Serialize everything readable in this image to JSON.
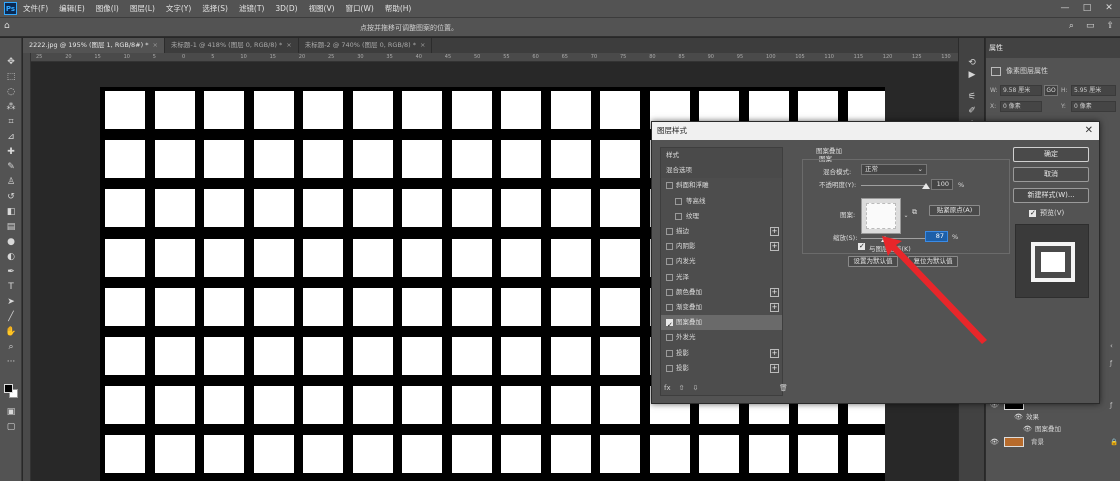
{
  "app": {
    "logo": "Ps"
  },
  "menu": [
    "文件(F)",
    "编辑(E)",
    "图像(I)",
    "图层(L)",
    "文字(Y)",
    "选择(S)",
    "滤镜(T)",
    "3D(D)",
    "视图(V)",
    "窗口(W)",
    "帮助(H)"
  ],
  "window_controls": {
    "minimize": "—",
    "maximize": "□",
    "close": "✕"
  },
  "options_bar": {
    "hint": "点按并拖移可调整图案的位置。"
  },
  "tabs": [
    {
      "label": "2222.jpg @ 195% (图层 1, RGB/8#) *",
      "close": "×"
    },
    {
      "label": "未标题-1 @ 418% (图层 0, RGB/8) *",
      "close": "×"
    },
    {
      "label": "未标题-2 @ 740% (图层 0, RGB/8) *",
      "close": "×"
    }
  ],
  "ruler_labels": [
    "25",
    "20",
    "15",
    "10",
    "5",
    "0",
    "5",
    "10",
    "15",
    "20",
    "25",
    "30",
    "35",
    "40",
    "45",
    "50",
    "55",
    "60",
    "65",
    "70",
    "75",
    "80",
    "85",
    "90",
    "95",
    "100",
    "105",
    "110",
    "115",
    "120",
    "125",
    "130"
  ],
  "properties": {
    "tab": "属性",
    "title": "像素图层属性",
    "w_label": "W:",
    "w_value": "9.58 厘米",
    "h_label": "H:",
    "h_value": "5.95 厘米",
    "x_label": "X:",
    "x_value": "0 像素",
    "y_label": "Y:",
    "y_value": "0 像素",
    "link": "GO"
  },
  "layers": {
    "effects_label": "效果",
    "pattern_overlay_label": "图案叠加",
    "background_label": "背景"
  },
  "dialog": {
    "title": "图层样式",
    "close": "✕",
    "styles": [
      {
        "label": "样式",
        "kind": "header"
      },
      {
        "label": "混合选项",
        "kind": "header"
      },
      {
        "label": "斜面和浮雕",
        "kind": "check",
        "checked": false
      },
      {
        "label": "等高线",
        "kind": "sub",
        "checked": false
      },
      {
        "label": "纹理",
        "kind": "sub",
        "checked": false
      },
      {
        "label": "描边",
        "kind": "check",
        "checked": false,
        "plus": "+"
      },
      {
        "label": "内阴影",
        "kind": "check",
        "checked": false,
        "plus": "+"
      },
      {
        "label": "内发光",
        "kind": "check",
        "checked": false
      },
      {
        "label": "光泽",
        "kind": "check",
        "checked": false
      },
      {
        "label": "颜色叠加",
        "kind": "check",
        "checked": false,
        "plus": "+"
      },
      {
        "label": "渐变叠加",
        "kind": "check",
        "checked": false,
        "plus": "+"
      },
      {
        "label": "图案叠加",
        "kind": "check",
        "checked": true,
        "selected": true
      },
      {
        "label": "外发光",
        "kind": "check",
        "checked": false
      },
      {
        "label": "投影",
        "kind": "check",
        "checked": false,
        "plus": "+"
      },
      {
        "label": "投影",
        "kind": "check",
        "checked": false,
        "plus": "+"
      }
    ],
    "footer": {
      "fx": "fx",
      "up": "⇧",
      "down": "⇩",
      "trash": "🗑"
    },
    "pattern_overlay": {
      "group_title": "图案叠加",
      "sub_title": "图案",
      "blend_mode_label": "混合模式:",
      "blend_mode_value": "正常",
      "opacity_label": "不透明度(Y):",
      "opacity_value": "100",
      "opacity_unit": "%",
      "opacity_level": 1.0,
      "pattern_label": "图案:",
      "snap_button": "贴紧原点(A)",
      "scale_label": "缩放(S):",
      "scale_value": "87",
      "scale_unit": "%",
      "link_checkbox_label": "与图层链接(K)",
      "link_checked": true,
      "set_default": "设置为默认值",
      "reset_default": "复位为默认值"
    },
    "buttons": {
      "ok": "确定",
      "cancel": "取消",
      "new_style": "新建样式(W)...",
      "preview_label": "预览(V)",
      "preview_checked": true
    }
  },
  "colors": {
    "accent_red": "#e8262a",
    "focus_blue": "#1d5fa8"
  }
}
